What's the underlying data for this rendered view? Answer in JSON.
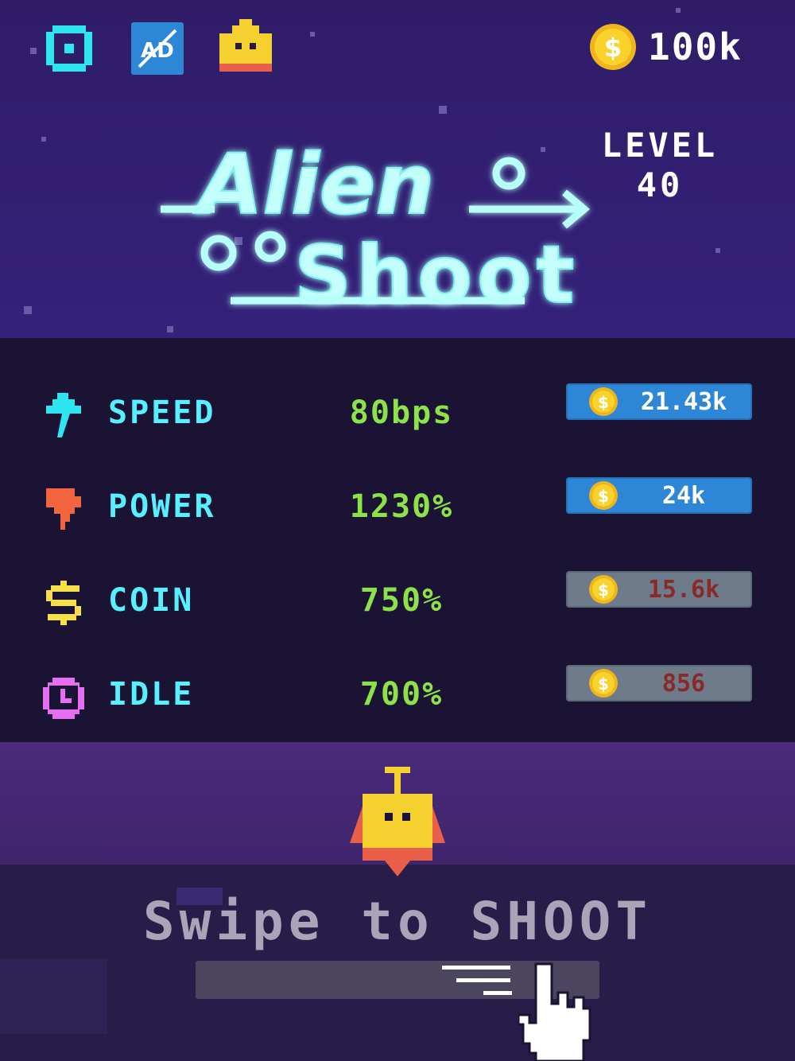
{
  "topbar": {
    "coin_total": "100k",
    "icons": [
      "settings-icon",
      "no-ads-icon",
      "skins-icon",
      "coin-icon"
    ]
  },
  "title": {
    "line1": "Alien",
    "line2": "Shoot"
  },
  "level": {
    "label": "LEVEL",
    "number": "40"
  },
  "upgrades": [
    {
      "name": "SPEED",
      "value": "80bps",
      "price": "21.43k",
      "affordable": true,
      "icon": "lightning-icon"
    },
    {
      "name": "POWER",
      "value": "1230%",
      "price": "24k",
      "affordable": true,
      "icon": "power-fist-icon"
    },
    {
      "name": "COIN",
      "value": "750%",
      "price": "15.6k",
      "affordable": false,
      "icon": "dollar-icon"
    },
    {
      "name": "IDLE",
      "value": "700%",
      "price": "856",
      "affordable": false,
      "icon": "clock-icon"
    }
  ],
  "prompt": {
    "text": "Swipe to SHOOT"
  },
  "colors": {
    "accent": "#57f0ff",
    "value_green": "#8de24a",
    "button_blue": "#2e86d6",
    "button_gray": "#6d7b8a",
    "coin_gold": "#f5c518"
  }
}
